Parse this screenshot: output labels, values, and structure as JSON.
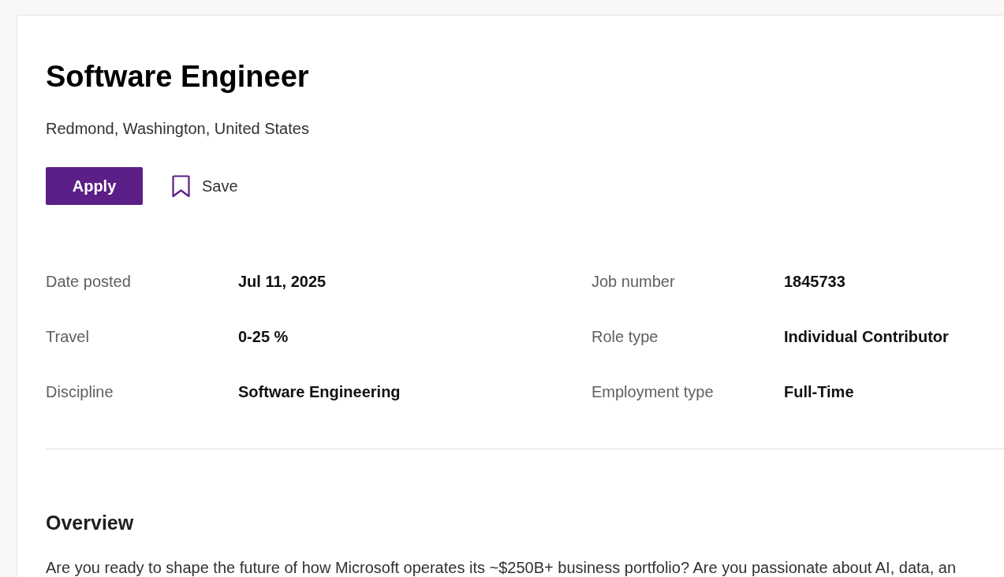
{
  "job": {
    "title": "Software Engineer",
    "location": "Redmond, Washington, United States"
  },
  "apply_button": {
    "label": "Apply"
  },
  "save_button": {
    "label": "Save",
    "saved": false
  },
  "details": [
    {
      "label": "Date posted",
      "value": "Jul 11, 2025"
    },
    {
      "label": "Job number",
      "value": "1845733"
    },
    {
      "label": "Travel",
      "value": "0-25 %"
    },
    {
      "label": "Role type",
      "value": "Individual Contributor"
    },
    {
      "label": "Discipline",
      "value": "Software Engineering"
    },
    {
      "label": "Employment type",
      "value": "Full-Time"
    }
  ],
  "overview": {
    "heading": "Overview",
    "text": "Are you ready to shape the future of how Microsoft operates its ~$250B+ business portfolio? Are you passionate about AI, data, an"
  }
}
